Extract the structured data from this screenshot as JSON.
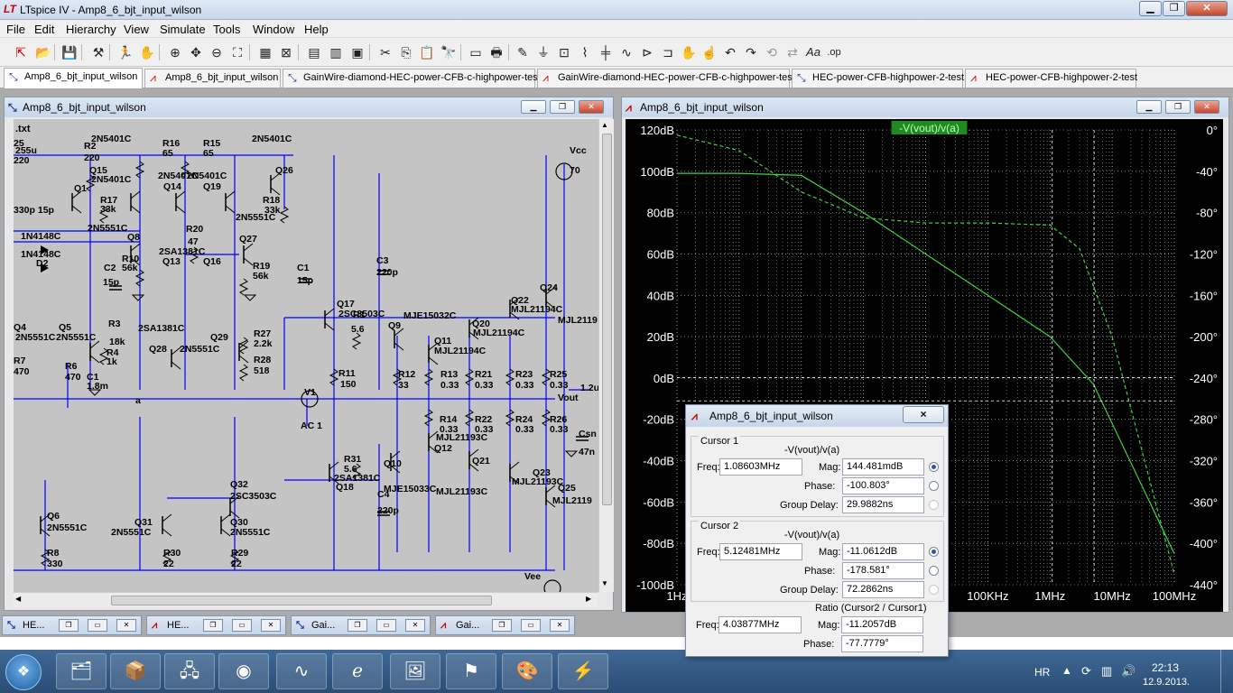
{
  "app": {
    "title": "LTspice IV - Amp8_6_bjt_input_wilson",
    "logo": "LT"
  },
  "menu": [
    "File",
    "Edit",
    "Hierarchy",
    "View",
    "Simulate",
    "Tools",
    "Window",
    "Help"
  ],
  "tabs": [
    {
      "label": "Amp8_6_bjt_input_wilson",
      "kind": "schematic",
      "active": true
    },
    {
      "label": "Amp8_6_bjt_input_wilson",
      "kind": "waveform"
    },
    {
      "label": "GainWire-diamond-HEC-power-CFB-c-highpower-test",
      "kind": "schematic"
    },
    {
      "label": "GainWire-diamond-HEC-power-CFB-c-highpower-test",
      "kind": "waveform"
    },
    {
      "label": "HEC-power-CFB-highpower-2-test",
      "kind": "schematic"
    },
    {
      "label": "HEC-power-CFB-highpower-2-test",
      "kind": "waveform"
    }
  ],
  "schematic": {
    "title": "Amp8_6_bjt_input_wilson",
    "directive": ".txt",
    "labels": [
      {
        "t": "25"
      },
      {
        "t": "255u"
      },
      {
        "t": "220"
      },
      {
        "t": "Q1"
      },
      {
        "t": "330p 15p"
      },
      {
        "t": "1N4148C"
      },
      {
        "t": "1N4148C"
      },
      {
        "t": "D2"
      },
      {
        "t": "R2"
      },
      {
        "t": "220"
      },
      {
        "t": "Q15"
      },
      {
        "t": "2N5401C"
      },
      {
        "t": "2N5401C"
      },
      {
        "t": "R17"
      },
      {
        "t": "33k"
      },
      {
        "t": "2N5551C"
      },
      {
        "t": "R16"
      },
      {
        "t": "65"
      },
      {
        "t": "R15"
      },
      {
        "t": "65"
      },
      {
        "t": "2N5401C"
      },
      {
        "t": "2N5401C"
      },
      {
        "t": "Q14"
      },
      {
        "t": "Q19"
      },
      {
        "t": "2N5401C"
      },
      {
        "t": "Q26"
      },
      {
        "t": "R18"
      },
      {
        "t": "33k"
      },
      {
        "t": "2N5551C"
      },
      {
        "t": "Q8"
      },
      {
        "t": "R20"
      },
      {
        "t": "47"
      },
      {
        "t": "2SA1381C"
      },
      {
        "t": "Q13"
      },
      {
        "t": "Q16"
      },
      {
        "t": "Q27"
      },
      {
        "t": "R10"
      },
      {
        "t": "56k"
      },
      {
        "t": "C2"
      },
      {
        "t": "15p"
      },
      {
        "t": "R19"
      },
      {
        "t": "56k"
      },
      {
        "t": "C1"
      },
      {
        "t": "15p"
      },
      {
        "t": "Vcc"
      },
      {
        "t": "70"
      },
      {
        "t": "C3"
      },
      {
        "t": "220p"
      },
      {
        "t": "Q24"
      },
      {
        "t": "Q22"
      },
      {
        "t": "MJL21194C"
      },
      {
        "t": "MJL2119"
      },
      {
        "t": "Q17"
      },
      {
        "t": "2SC3503C"
      },
      {
        "t": "R1"
      },
      {
        "t": "5.6"
      },
      {
        "t": "Q9"
      },
      {
        "t": "MJE15032C"
      },
      {
        "t": "Q20"
      },
      {
        "t": "MJL21194C"
      },
      {
        "t": "Q11"
      },
      {
        "t": "MJL21194C"
      },
      {
        "t": "Q4"
      },
      {
        "t": "Q5"
      },
      {
        "t": "2N5551C"
      },
      {
        "t": "2N5551C"
      },
      {
        "t": "R3"
      },
      {
        "t": "18k"
      },
      {
        "t": "R7"
      },
      {
        "t": "470"
      },
      {
        "t": "R6"
      },
      {
        "t": "470"
      },
      {
        "t": "R4"
      },
      {
        "t": "1k"
      },
      {
        "t": "C1"
      },
      {
        "t": "1.8m"
      },
      {
        "t": "2SA1381C"
      },
      {
        "t": "Q28"
      },
      {
        "t": "Q29"
      },
      {
        "t": "2N5551C"
      },
      {
        "t": "R27"
      },
      {
        "t": "2.2k"
      },
      {
        "t": "R28"
      },
      {
        "t": "518"
      },
      {
        "t": "R11"
      },
      {
        "t": "150"
      },
      {
        "t": "R12"
      },
      {
        "t": "33"
      },
      {
        "t": "R13"
      },
      {
        "t": "0.33"
      },
      {
        "t": "R21"
      },
      {
        "t": "0.33"
      },
      {
        "t": "R23"
      },
      {
        "t": "0.33"
      },
      {
        "t": "R25"
      },
      {
        "t": "0.33"
      },
      {
        "t": "a"
      },
      {
        "t": "V1"
      },
      {
        "t": "AC 1"
      },
      {
        "t": "Vout"
      },
      {
        "t": "R14"
      },
      {
        "t": "0.33"
      },
      {
        "t": "R22"
      },
      {
        "t": "0.33"
      },
      {
        "t": "R24"
      },
      {
        "t": "0.33"
      },
      {
        "t": "R26"
      },
      {
        "t": "0.33"
      },
      {
        "t": "Q12"
      },
      {
        "t": "MJL21193C"
      },
      {
        "t": "Csn"
      },
      {
        "t": "47n"
      },
      {
        "t": "R31"
      },
      {
        "t": "5.6"
      },
      {
        "t": "2SA1381C"
      },
      {
        "t": "Q18"
      },
      {
        "t": "Q10"
      },
      {
        "t": "MJE15033C"
      },
      {
        "t": "Q21"
      },
      {
        "t": "MJL21193C"
      },
      {
        "t": "Q23"
      },
      {
        "t": "MJL21193C"
      },
      {
        "t": "Q25"
      },
      {
        "t": "MJL2119"
      },
      {
        "t": "C4"
      },
      {
        "t": "220p"
      },
      {
        "t": "Q32"
      },
      {
        "t": "2SC3503C"
      },
      {
        "t": "Q6"
      },
      {
        "t": "2N5551C"
      },
      {
        "t": "Q31"
      },
      {
        "t": "2N5551C"
      },
      {
        "t": "Q30"
      },
      {
        "t": "2N5551C"
      },
      {
        "t": "R8"
      },
      {
        "t": "330"
      },
      {
        "t": "R30"
      },
      {
        "t": "22"
      },
      {
        "t": "R29"
      },
      {
        "t": "22"
      },
      {
        "t": "Vee"
      },
      {
        "t": "1.2u"
      }
    ]
  },
  "plot": {
    "title": "Amp8_6_bjt_input_wilson",
    "trace_label": "-V(vout)/v(a)",
    "trace_color": "#3fd13f",
    "background": "#000000",
    "grid_color": "#c8c8c8"
  },
  "chart_data": {
    "type": "line",
    "title": "-V(vout)/v(a)",
    "xscale": "log",
    "xlim_hz": [
      1,
      100000000
    ],
    "xticks": [
      "1Hz",
      "10Hz",
      "100Hz",
      "1KHz",
      "10KHz",
      "100KHz",
      "1MHz",
      "10MHz",
      "100MHz"
    ],
    "ylim_db": [
      -100,
      120
    ],
    "yticks_left": [
      "120dB",
      "100dB",
      "80dB",
      "60dB",
      "40dB",
      "20dB",
      "0dB",
      "-20dB",
      "-40dB",
      "-60dB",
      "-80dB",
      "-100dB"
    ],
    "ylim_phase_deg": [
      -440,
      0
    ],
    "yticks_right": [
      "0°",
      "-40°",
      "-80°",
      "-120°",
      "-160°",
      "-200°",
      "-240°",
      "-280°",
      "-320°",
      "-360°",
      "-400°",
      "-440°"
    ],
    "grid": true,
    "series": [
      {
        "name": "-V(vout)/v(a)",
        "style": "solid",
        "quantity": "magnitude",
        "x_hz": [
          1,
          10,
          100,
          1000,
          10000,
          100000,
          1000000,
          5000000,
          10000000,
          100000000
        ],
        "y": [
          99,
          99,
          98,
          80,
          60,
          40,
          20,
          -3,
          -22,
          -85
        ]
      },
      {
        "name": "-V(vout)/v(a)",
        "style": "dashed",
        "quantity": "phase",
        "x_hz": [
          1,
          10,
          100,
          1000,
          10000,
          100000,
          1000000,
          3000000,
          10000000,
          100000000
        ],
        "y": [
          -5,
          -20,
          -60,
          -85,
          -90,
          -90,
          -92,
          -115,
          -200,
          -430
        ]
      }
    ],
    "cursors": [
      {
        "x_hz": 1086030,
        "y_db": 0.144
      },
      {
        "x_hz": 5124810,
        "y_db": -11.06
      }
    ]
  },
  "cursor_dialog": {
    "title": "Amp8_6_bjt_input_wilson",
    "close": "×",
    "cursor1": {
      "label": "Cursor 1",
      "expr": "-V(vout)/v(a)",
      "freq_label": "Freq:",
      "freq": "1.08603MHz",
      "mag_label": "Mag:",
      "mag": "144.481mdB",
      "phase_label": "Phase:",
      "phase": "-100.803°",
      "gd_label": "Group Delay:",
      "gd": "29.9882ns"
    },
    "cursor2": {
      "label": "Cursor 2",
      "expr": "-V(vout)/v(a)",
      "freq_label": "Freq:",
      "freq": "5.12481MHz",
      "mag_label": "Mag:",
      "mag": "-11.0612dB",
      "phase_label": "Phase:",
      "phase": "-178.581°",
      "gd_label": "Group Delay:",
      "gd": "72.2862ns"
    },
    "ratio": {
      "label": "Ratio (Cursor2 / Cursor1)",
      "freq_label": "Freq:",
      "freq": "4.03877MHz",
      "mag_label": "Mag:",
      "mag": "-11.2057dB",
      "phase_label": "Phase:",
      "phase": "-77.7779°"
    }
  },
  "minimized": [
    {
      "label": "HE...",
      "kind": "schematic"
    },
    {
      "label": "HE...",
      "kind": "waveform"
    },
    {
      "label": "Gai...",
      "kind": "schematic"
    },
    {
      "label": "Gai...",
      "kind": "waveform"
    }
  ],
  "taskbar": {
    "lang": "HR",
    "time": "22:13",
    "date": "12.9.2013.",
    "apps": [
      "explorer",
      "package",
      "network",
      "antivirus",
      "oscilloscope",
      "internet-explorer",
      "photos",
      "pdf-reader",
      "paint",
      "ltspice"
    ]
  }
}
